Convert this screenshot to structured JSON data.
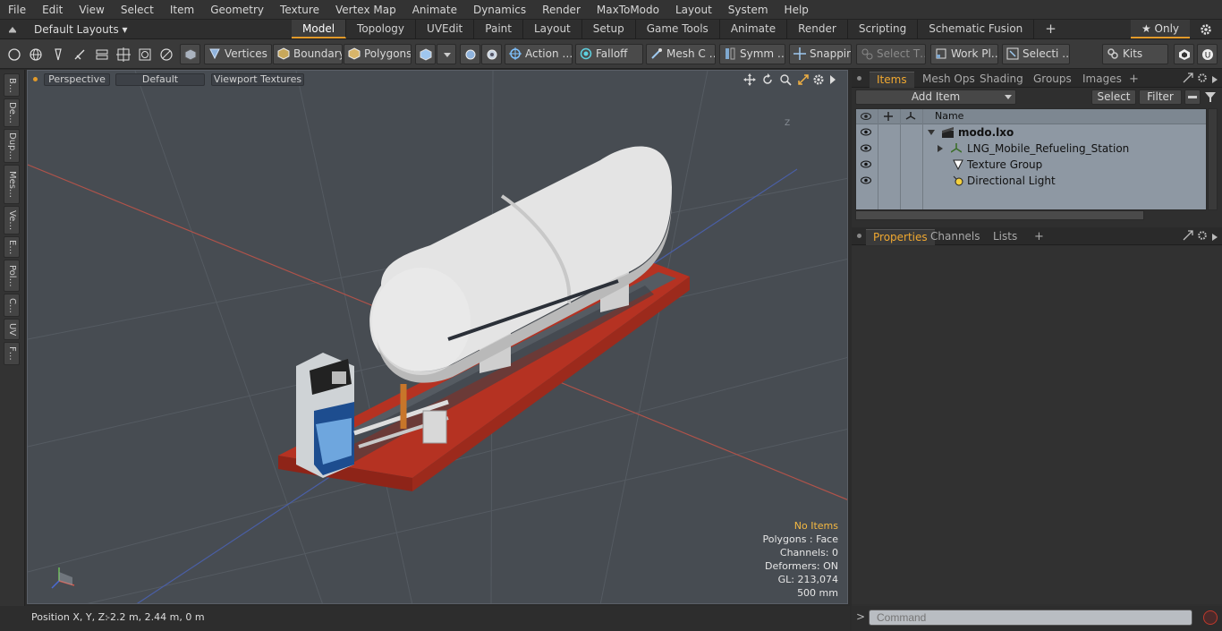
{
  "menu": [
    "File",
    "Edit",
    "View",
    "Select",
    "Item",
    "Geometry",
    "Texture",
    "Vertex Map",
    "Animate",
    "Dynamics",
    "Render",
    "MaxToModo",
    "Layout",
    "System",
    "Help"
  ],
  "layout": {
    "preset": "Default Layouts ▾",
    "tabs": [
      "Model",
      "Topology",
      "UVEdit",
      "Paint",
      "Layout",
      "Setup",
      "Game Tools",
      "Animate",
      "Render",
      "Scripting",
      "Schematic Fusion"
    ],
    "active_tab": "Model",
    "add": "+",
    "only": "★ Only"
  },
  "toolbar": {
    "vertices": "Vertices",
    "boundary": "Boundary",
    "polygons": "Polygons",
    "action": "Action …",
    "falloff": "Falloff",
    "mesh": "Mesh C …",
    "symm": "Symm …",
    "snapping": "Snapping",
    "select_t": "Select T…",
    "work_plane": "Work Pl…",
    "selection": "Selecti …",
    "kits": "Kits"
  },
  "left_tabs": [
    "B…",
    "De…",
    "Dup…",
    "Mes…",
    "Ve…",
    "E…",
    "Pol…",
    "C…",
    "UV",
    "F…"
  ],
  "viewport": {
    "view": "Perspective",
    "shading": "Default",
    "textures": "Viewport Textures",
    "info": {
      "items": "No Items",
      "polygons": "Polygons : Face",
      "channels": "Channels: 0",
      "deformers": "Deformers: ON",
      "gl": "GL: 213,074",
      "scale": "500 mm"
    },
    "axis_z_label": "Z"
  },
  "status": {
    "position_label": "Position X, Y, Z:",
    "position_value": "-2.2 m, 2.44 m, 0 m"
  },
  "items_panel": {
    "tabs": [
      "Items",
      "Mesh Ops",
      "Shading",
      "Groups",
      "Images"
    ],
    "active_tab": "Items",
    "add_item": "Add Item",
    "select": "Select",
    "filter": "Filter",
    "column_name": "Name",
    "tree": [
      {
        "label": "modo.lxo"
      },
      {
        "label": "LNG_Mobile_Refueling_Station"
      },
      {
        "label": "Texture Group"
      },
      {
        "label": "Directional Light"
      }
    ]
  },
  "properties_panel": {
    "tabs": [
      "Properties",
      "Channels",
      "Lists"
    ],
    "active_tab": "Properties",
    "add": "+"
  },
  "command": {
    "placeholder": "Command",
    "prompt": ">"
  },
  "colors": {
    "accent": "#e29a2a",
    "viewport_bg": "#474c52",
    "frame_red": "#c83524",
    "tank_white": "#e4e4e4"
  }
}
